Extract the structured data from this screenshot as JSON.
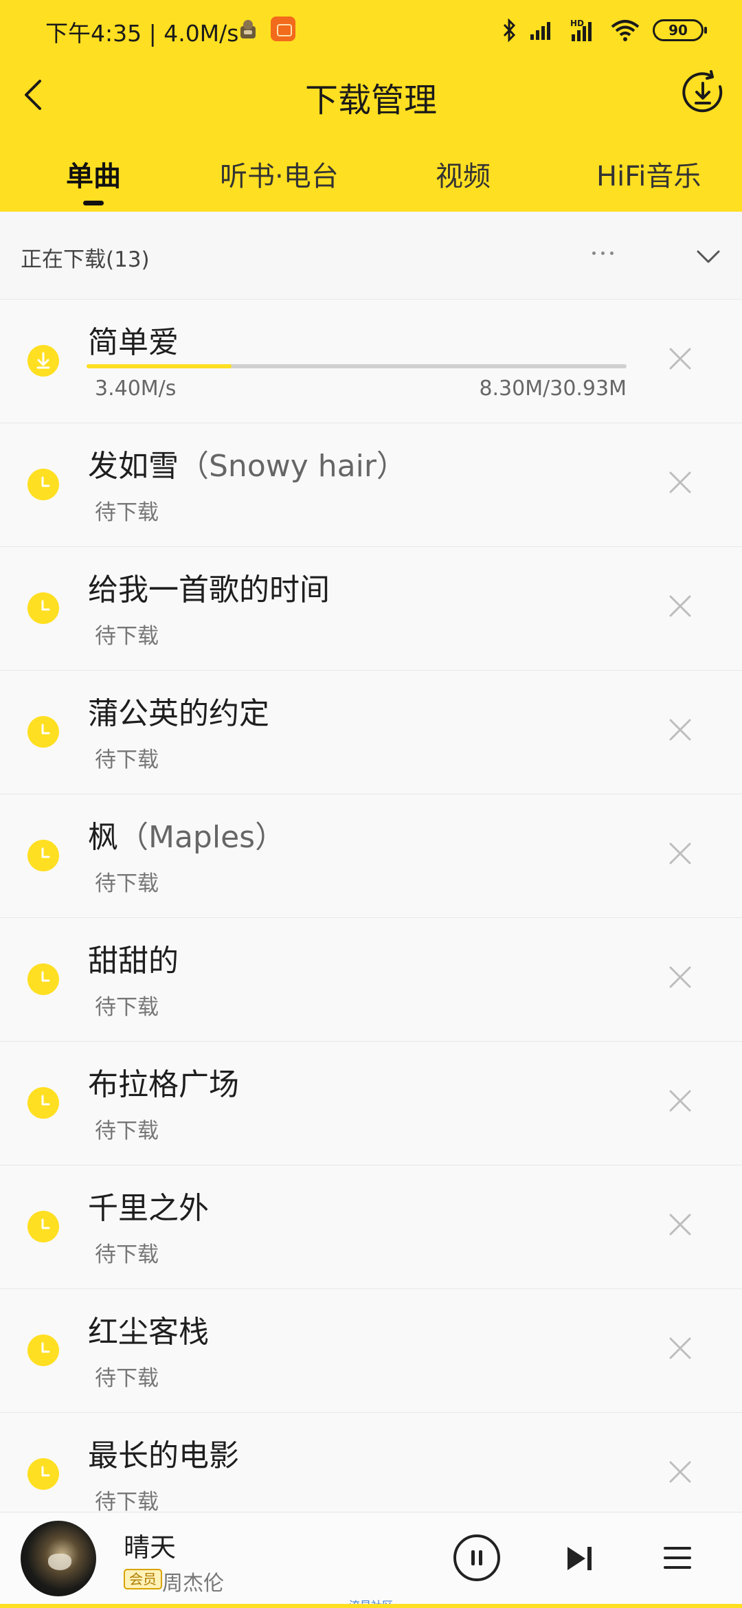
{
  "status_bar": {
    "time": "下午4:35 | 4.0M/s",
    "battery": "90"
  },
  "nav": {
    "title": "下载管理"
  },
  "tabs": [
    {
      "label": "单曲",
      "active": true
    },
    {
      "label": "听书·电台",
      "active": false
    },
    {
      "label": "视频",
      "active": false
    },
    {
      "label": "HiFi音乐",
      "active": false
    }
  ],
  "section": {
    "title": "正在下载(13)"
  },
  "downloading": {
    "title": "简单爱",
    "speed": "3.40M/s",
    "size": "8.30M/30.93M",
    "progress": 0.268
  },
  "list": [
    {
      "title": "发如雪",
      "subtitle": "（Snowy hair）",
      "status": "待下载"
    },
    {
      "title": "给我一首歌的时间",
      "subtitle": "",
      "status": "待下载"
    },
    {
      "title": "蒲公英的约定",
      "subtitle": "",
      "status": "待下载"
    },
    {
      "title": "枫",
      "subtitle": "（Maples）",
      "status": "待下载"
    },
    {
      "title": "甜甜的",
      "subtitle": "",
      "status": "待下载"
    },
    {
      "title": "布拉格广场",
      "subtitle": "",
      "status": "待下载"
    },
    {
      "title": "千里之外",
      "subtitle": "",
      "status": "待下载"
    },
    {
      "title": "红尘客栈",
      "subtitle": "",
      "status": "待下载"
    },
    {
      "title": "最长的电影",
      "subtitle": "",
      "status": "待下载"
    }
  ],
  "player": {
    "song": "晴天",
    "badge": "会员",
    "artist": "周杰伦",
    "footer": "流星社区"
  },
  "colors": {
    "accent": "#ffdf21",
    "background": "#f7f7f7"
  }
}
